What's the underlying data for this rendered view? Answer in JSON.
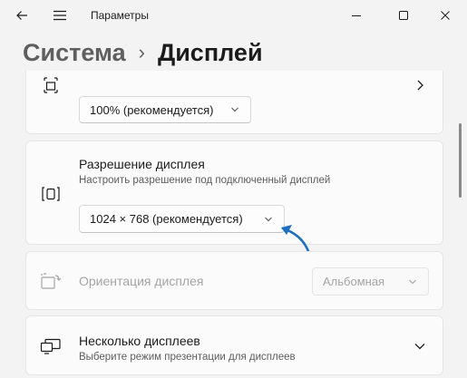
{
  "window": {
    "title": "Параметры",
    "back_icon": "back-arrow-icon",
    "menu_icon": "hamburger-menu-icon",
    "controls": [
      "minimize",
      "maximize",
      "close"
    ]
  },
  "breadcrumb": {
    "parent": "Система",
    "separator": "›",
    "current": "Дисплей"
  },
  "scale_card": {
    "icon": "scale-icon",
    "dropdown_value": "100% (рекомендуется)",
    "chevron_icon": "chevron-right-icon"
  },
  "resolution_card": {
    "icon": "resolution-icon",
    "title": "Разрешение дисплея",
    "subtitle": "Настроить разрешение под подключенный дисплей",
    "dropdown_value": "1024 × 768 (рекомендуется)"
  },
  "orientation_card": {
    "icon": "orientation-icon",
    "title": "Ориентация дисплея",
    "dropdown_value": "Альбомная",
    "disabled": true
  },
  "multi_display_card": {
    "icon": "multiple-displays-icon",
    "title": "Несколько дисплеев",
    "subtitle": "Выберите режим презентации для дисплеев"
  },
  "colors": {
    "accent_arrow": "#1e6fbf",
    "background": "#f3f3f3",
    "card": "#fbfbfb"
  }
}
